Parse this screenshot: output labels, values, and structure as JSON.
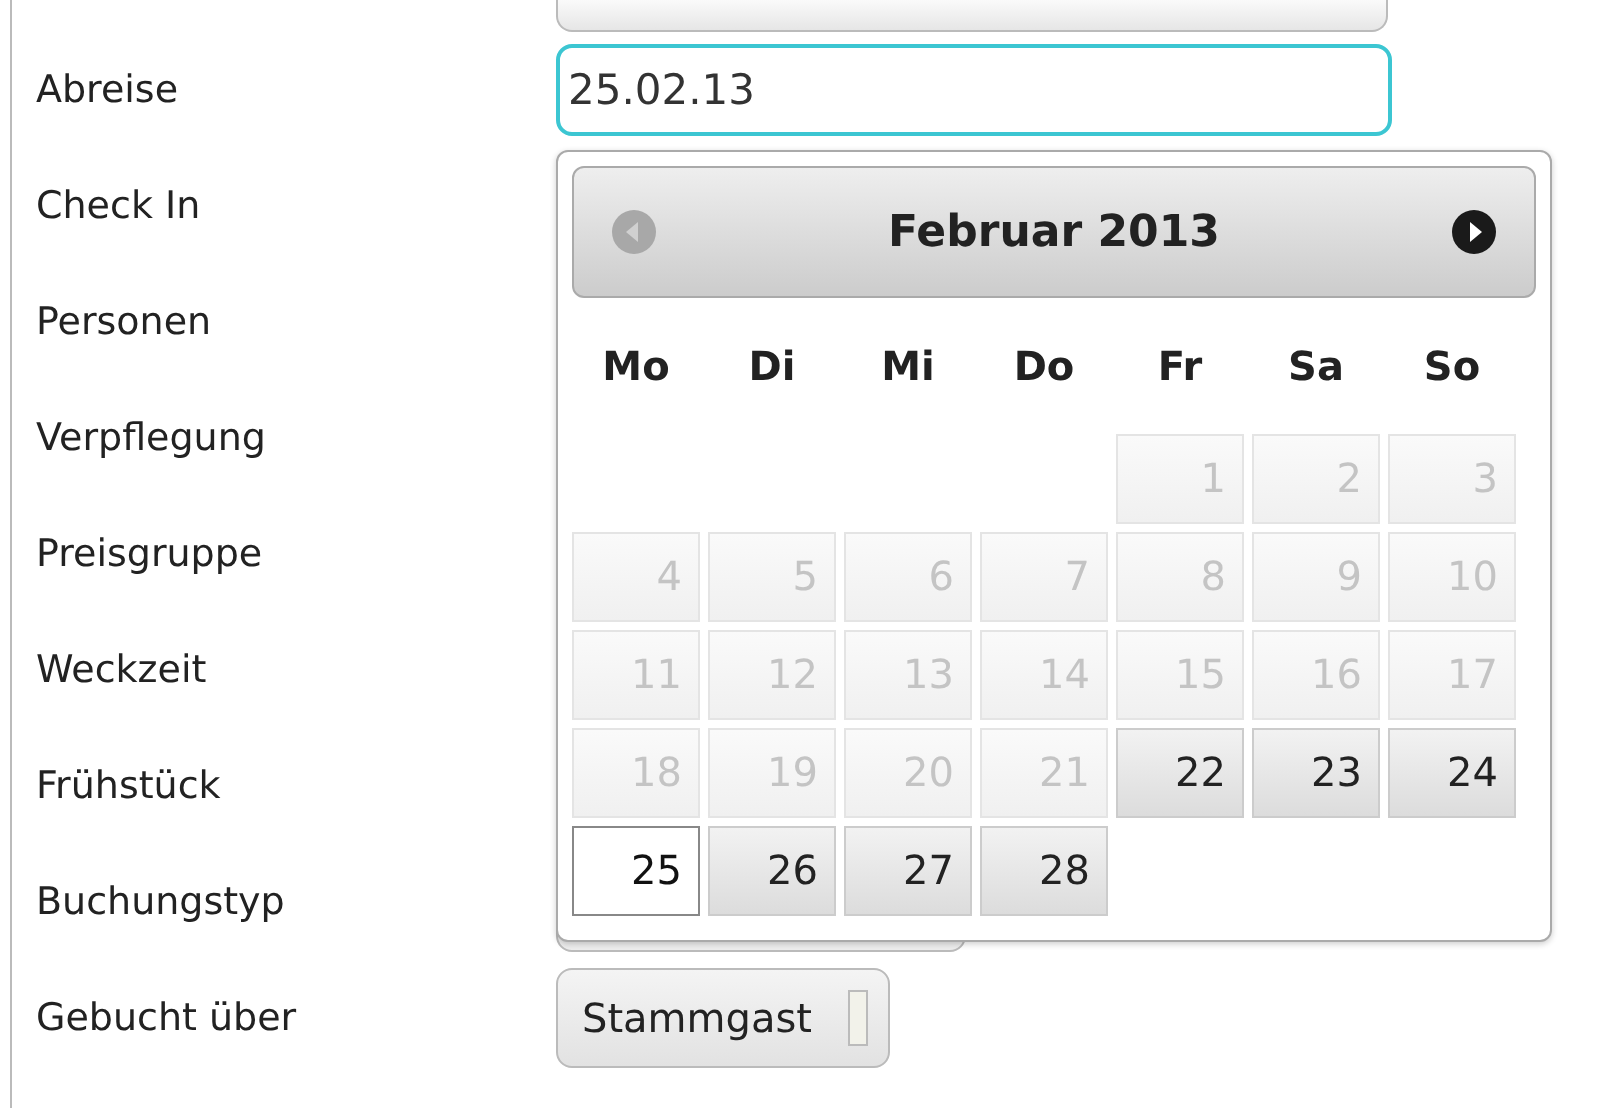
{
  "form": {
    "rows": [
      {
        "label": "Abreise",
        "field": {
          "kind": "date",
          "value": "25.02.13",
          "focused": true
        }
      },
      {
        "label": "Check In"
      },
      {
        "label": "Personen"
      },
      {
        "label": "Verpflegung"
      },
      {
        "label": "Preisgruppe"
      },
      {
        "label": "Weckzeit"
      },
      {
        "label": "Frühstück"
      },
      {
        "label": "Buchungstyp",
        "field": {
          "kind": "select-covered"
        }
      },
      {
        "label": "Gebucht über",
        "field": {
          "kind": "select",
          "value": "Stammgast"
        }
      }
    ]
  },
  "datepicker": {
    "title": "Februar 2013",
    "prev_disabled": true,
    "next_disabled": false,
    "weekdays": [
      "Mo",
      "Di",
      "Mi",
      "Do",
      "Fr",
      "Sa",
      "So"
    ],
    "weeks": [
      [
        {
          "kind": "blank"
        },
        {
          "kind": "blank"
        },
        {
          "kind": "blank"
        },
        {
          "kind": "blank"
        },
        {
          "day": "1",
          "disabled": true,
          "selected": false
        },
        {
          "day": "2",
          "disabled": true,
          "selected": false
        },
        {
          "day": "3",
          "disabled": true,
          "selected": false
        }
      ],
      [
        {
          "day": "4",
          "disabled": true,
          "selected": false
        },
        {
          "day": "5",
          "disabled": true,
          "selected": false
        },
        {
          "day": "6",
          "disabled": true,
          "selected": false
        },
        {
          "day": "7",
          "disabled": true,
          "selected": false
        },
        {
          "day": "8",
          "disabled": true,
          "selected": false
        },
        {
          "day": "9",
          "disabled": true,
          "selected": false
        },
        {
          "day": "10",
          "disabled": true,
          "selected": false
        }
      ],
      [
        {
          "day": "11",
          "disabled": true,
          "selected": false
        },
        {
          "day": "12",
          "disabled": true,
          "selected": false
        },
        {
          "day": "13",
          "disabled": true,
          "selected": false
        },
        {
          "day": "14",
          "disabled": true,
          "selected": false
        },
        {
          "day": "15",
          "disabled": true,
          "selected": false
        },
        {
          "day": "16",
          "disabled": true,
          "selected": false
        },
        {
          "day": "17",
          "disabled": true,
          "selected": false
        }
      ],
      [
        {
          "day": "18",
          "disabled": true,
          "selected": false
        },
        {
          "day": "19",
          "disabled": true,
          "selected": false
        },
        {
          "day": "20",
          "disabled": true,
          "selected": false
        },
        {
          "day": "21",
          "disabled": true,
          "selected": false
        },
        {
          "day": "22",
          "disabled": false,
          "selected": false
        },
        {
          "day": "23",
          "disabled": false,
          "selected": false
        },
        {
          "day": "24",
          "disabled": false,
          "selected": false
        }
      ],
      [
        {
          "day": "25",
          "disabled": false,
          "selected": true
        },
        {
          "day": "26",
          "disabled": false,
          "selected": false
        },
        {
          "day": "27",
          "disabled": false,
          "selected": false
        },
        {
          "day": "28",
          "disabled": false,
          "selected": false
        },
        {
          "kind": "blank"
        },
        {
          "kind": "blank"
        },
        {
          "kind": "blank"
        }
      ]
    ]
  }
}
